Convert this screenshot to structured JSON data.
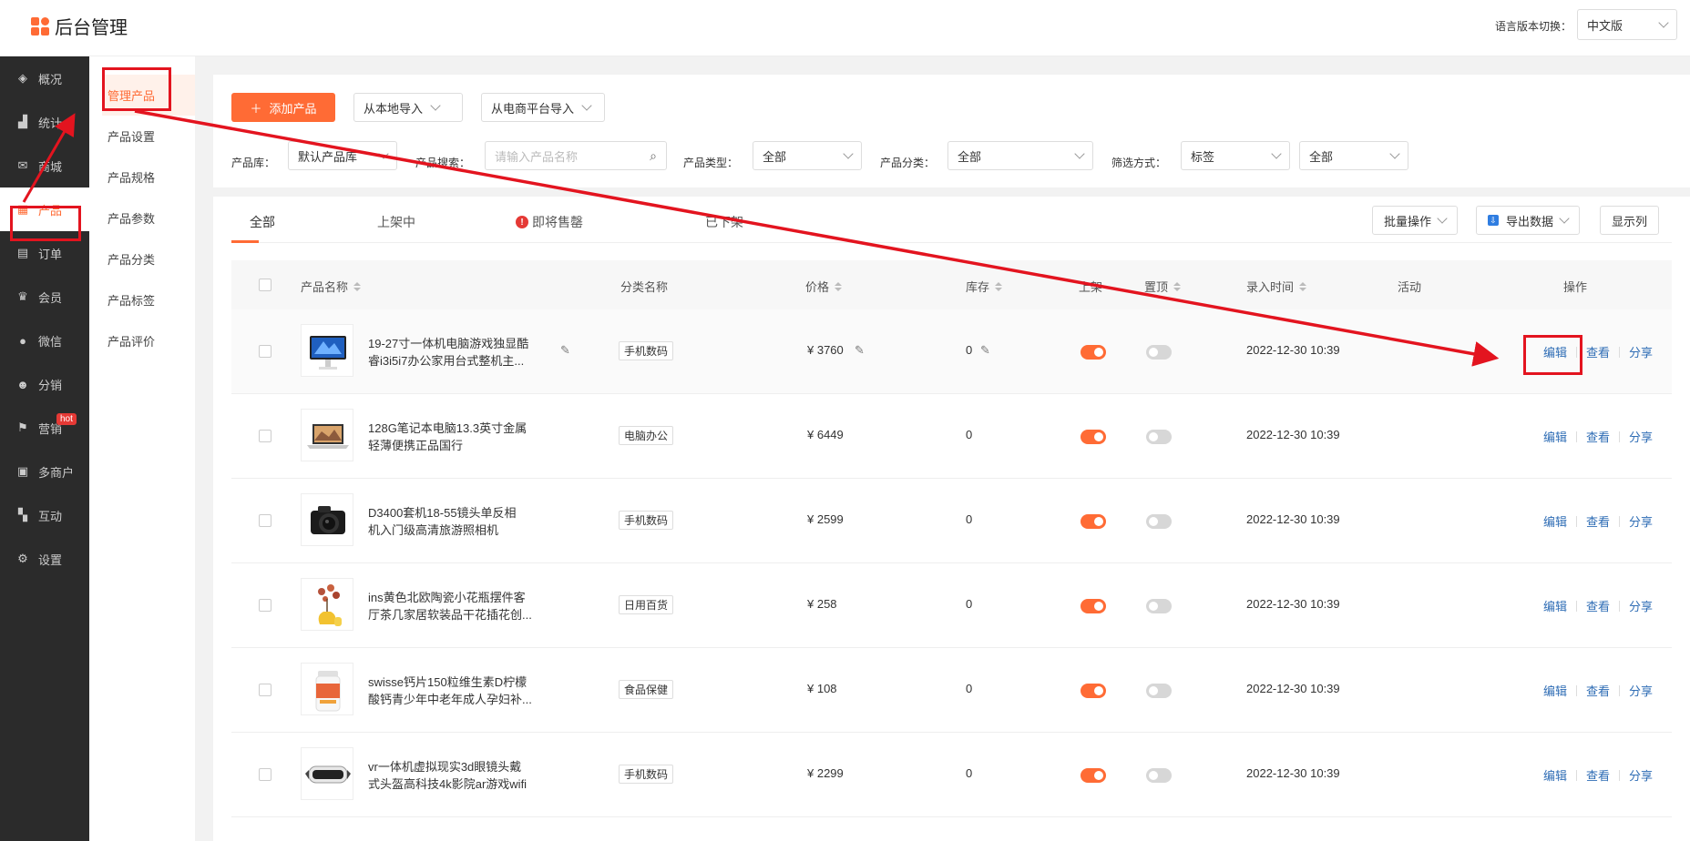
{
  "header": {
    "title": "后台管理",
    "lang_label": "语言版本切换：",
    "lang_value": "中文版"
  },
  "sidebar": {
    "items": [
      {
        "label": "概况",
        "icon": "layers-icon"
      },
      {
        "label": "统计",
        "icon": "chart-icon"
      },
      {
        "label": "商城",
        "icon": "mail-icon"
      },
      {
        "label": "产品",
        "icon": "apps-icon"
      },
      {
        "label": "订单",
        "icon": "clipboard-icon"
      },
      {
        "label": "会员",
        "icon": "crown-icon"
      },
      {
        "label": "微信",
        "icon": "wechat-icon"
      },
      {
        "label": "分销",
        "icon": "users-icon"
      },
      {
        "label": "营销",
        "icon": "flag-icon",
        "badge": "hot"
      },
      {
        "label": "多商户",
        "icon": "store-icon"
      },
      {
        "label": "互动",
        "icon": "interact-icon"
      },
      {
        "label": "设置",
        "icon": "gear-icon"
      }
    ]
  },
  "submenu": {
    "items": [
      "管理产品",
      "产品设置",
      "产品规格",
      "产品参数",
      "产品分类",
      "产品标签",
      "产品评价"
    ]
  },
  "toolbar": {
    "add_label": "添加产品",
    "import_local": "从本地导入",
    "import_platform": "从电商平台导入"
  },
  "filters": {
    "library_label": "产品库：",
    "library_value": "默认产品库",
    "search_label": "产品搜索：",
    "search_placeholder": "请输入产品名称",
    "type_label": "产品类型：",
    "type_value": "全部",
    "category_label": "产品分类：",
    "category_value": "全部",
    "filter_label": "筛选方式：",
    "filter_value": "标签",
    "filter_value2": "全部"
  },
  "tabs": [
    "全部",
    "上架中",
    "即将售罄",
    "已下架"
  ],
  "actions": {
    "batch": "批量操作",
    "export": "导出数据",
    "columns": "显示列"
  },
  "table": {
    "headers": {
      "name": "产品名称",
      "category": "分类名称",
      "price": "价格",
      "stock": "库存",
      "shelf": "上架",
      "top": "置顶",
      "time": "录入时间",
      "activity": "活动",
      "ops": "操作"
    },
    "op_labels": {
      "edit": "编辑",
      "view": "查看",
      "share": "分享"
    },
    "rows": [
      {
        "name1": "19-27寸一体机电脑游戏独显酷",
        "name2": "睿i3i5i7办公家用台式整机主...",
        "category": "手机数码",
        "price": "¥ 3760",
        "stock": "0",
        "time": "2022-12-30 10:39"
      },
      {
        "name1": "128G笔记本电脑13.3英寸金属",
        "name2": "轻薄便携正品国行",
        "category": "电脑办公",
        "price": "¥ 6449",
        "stock": "0",
        "time": "2022-12-30 10:39"
      },
      {
        "name1": "D3400套机18-55镜头单反相",
        "name2": "机入门级高清旅游照相机",
        "category": "手机数码",
        "price": "¥ 2599",
        "stock": "0",
        "time": "2022-12-30 10:39"
      },
      {
        "name1": "ins黄色北欧陶瓷小花瓶摆件客",
        "name2": "厅茶几家居软装品干花插花创...",
        "category": "日用百货",
        "price": "¥ 258",
        "stock": "0",
        "time": "2022-12-30 10:39"
      },
      {
        "name1": "swisse钙片150粒维生素D柠檬",
        "name2": "酸钙青少年中老年成人孕妇补...",
        "category": "食品保健",
        "price": "¥ 108",
        "stock": "0",
        "time": "2022-12-30 10:39"
      },
      {
        "name1": "vr一体机虚拟现实3d眼镜头戴",
        "name2": "式头盔高科技4k影院ar游戏wifi",
        "category": "手机数码",
        "price": "¥ 2299",
        "stock": "0",
        "time": "2022-12-30 10:39"
      }
    ]
  }
}
